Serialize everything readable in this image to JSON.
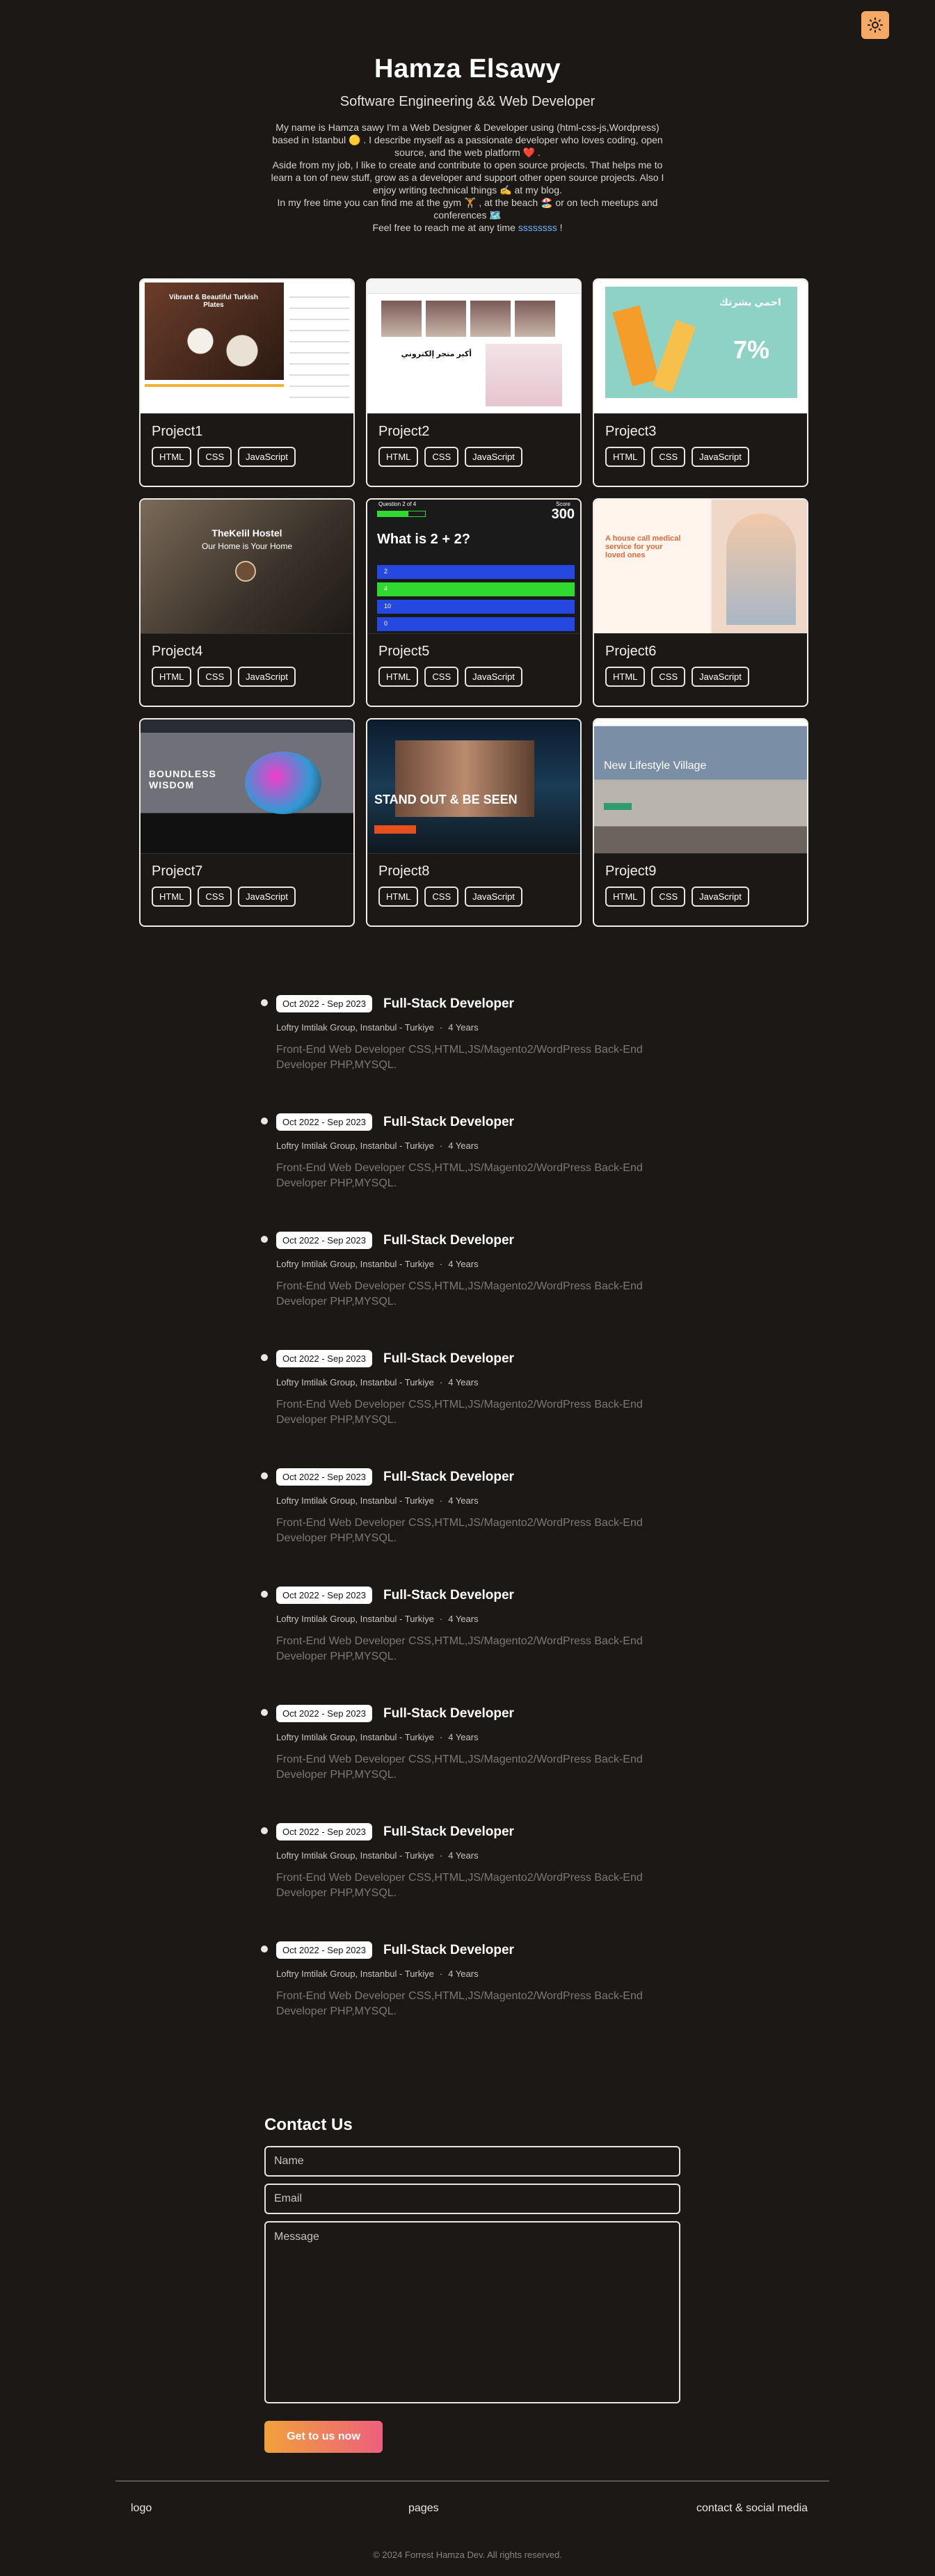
{
  "theme": {
    "toggle_icon": "sun-icon",
    "accent": "#f6a865"
  },
  "hero": {
    "name": "Hamza Elsawy",
    "title": "Software Engineering && Web Developer",
    "bio_lines": [
      "My name is Hamza sawy I'm a Web Designer & Developer using (html-css-js,Wordpress) based in Istanbul 🟡 . I describe myself as a passionate developer who loves coding, open source, and the web platform ❤️ .",
      "Aside from my job, I like to create and contribute to open source projects. That helps me to learn a ton of new stuff, grow as a developer and support other open source projects. Also I enjoy writing technical things ✍️ at my blog.",
      "In my free time you can find me at the gym 🏋️ , at the beach 🏖️ or on tech meetups and conferences 🗺️"
    ],
    "reach_prefix": "Feel free to reach me at any time",
    "reach_link": "ssssssss",
    "reach_suffix": "!"
  },
  "projects": [
    {
      "title": "Project1",
      "tags": [
        "HTML",
        "CSS",
        "JavaScript"
      ]
    },
    {
      "title": "Project2",
      "tags": [
        "HTML",
        "CSS",
        "JavaScript"
      ]
    },
    {
      "title": "Project3",
      "tags": [
        "HTML",
        "CSS",
        "JavaScript"
      ]
    },
    {
      "title": "Project4",
      "tags": [
        "HTML",
        "CSS",
        "JavaScript"
      ]
    },
    {
      "title": "Project5",
      "tags": [
        "HTML",
        "CSS",
        "JavaScript"
      ]
    },
    {
      "title": "Project6",
      "tags": [
        "HTML",
        "CSS",
        "JavaScript"
      ]
    },
    {
      "title": "Project7",
      "tags": [
        "HTML",
        "CSS",
        "JavaScript"
      ]
    },
    {
      "title": "Project8",
      "tags": [
        "HTML",
        "CSS",
        "JavaScript"
      ]
    },
    {
      "title": "Project9",
      "tags": [
        "HTML",
        "CSS",
        "JavaScript"
      ]
    }
  ],
  "thumbs": {
    "p1_heading": "Vibrant & Beautiful Turkish Plates",
    "p2_heading": "أكبر متجر إلكتروني",
    "p3_heading": "احمي بشرتك",
    "p3_percent": "7%",
    "p4_heading": "TheKelil Hostel",
    "p4_sub": "Our Home is Your Home",
    "p5_counter": "Question 2 of 4",
    "p5_score_label": "Score",
    "p5_score": "300",
    "p5_question": "What is 2 + 2?",
    "p5_answers": [
      "2",
      "4",
      "10",
      "0"
    ],
    "p6_heading": "A house call medical service for your loved ones",
    "p7_heading": "BOUNDLESS WISDOM",
    "p8_heading": "STAND OUT & BE SEEN",
    "p9_heading": "New Lifestyle Village"
  },
  "experience": [
    {
      "date": "Oct 2022 - Sep 2023",
      "role": "Full-Stack Developer",
      "company": "Loftry Imtilak Group, Instanbul - Turkiye",
      "duration": "4 Years",
      "description": "Front-End Web Developer CSS,HTML,JS/Magento2/WordPress Back-End Developer PHP,MYSQL."
    },
    {
      "date": "Oct 2022 - Sep 2023",
      "role": "Full-Stack Developer",
      "company": "Loftry Imtilak Group, Instanbul - Turkiye",
      "duration": "4 Years",
      "description": "Front-End Web Developer CSS,HTML,JS/Magento2/WordPress Back-End Developer PHP,MYSQL."
    },
    {
      "date": "Oct 2022 - Sep 2023",
      "role": "Full-Stack Developer",
      "company": "Loftry Imtilak Group, Instanbul - Turkiye",
      "duration": "4 Years",
      "description": "Front-End Web Developer CSS,HTML,JS/Magento2/WordPress Back-End Developer PHP,MYSQL."
    },
    {
      "date": "Oct 2022 - Sep 2023",
      "role": "Full-Stack Developer",
      "company": "Loftry Imtilak Group, Instanbul - Turkiye",
      "duration": "4 Years",
      "description": "Front-End Web Developer CSS,HTML,JS/Magento2/WordPress Back-End Developer PHP,MYSQL."
    },
    {
      "date": "Oct 2022 - Sep 2023",
      "role": "Full-Stack Developer",
      "company": "Loftry Imtilak Group, Instanbul - Turkiye",
      "duration": "4 Years",
      "description": "Front-End Web Developer CSS,HTML,JS/Magento2/WordPress Back-End Developer PHP,MYSQL."
    },
    {
      "date": "Oct 2022 - Sep 2023",
      "role": "Full-Stack Developer",
      "company": "Loftry Imtilak Group, Instanbul - Turkiye",
      "duration": "4 Years",
      "description": "Front-End Web Developer CSS,HTML,JS/Magento2/WordPress Back-End Developer PHP,MYSQL."
    },
    {
      "date": "Oct 2022 - Sep 2023",
      "role": "Full-Stack Developer",
      "company": "Loftry Imtilak Group, Instanbul - Turkiye",
      "duration": "4 Years",
      "description": "Front-End Web Developer CSS,HTML,JS/Magento2/WordPress Back-End Developer PHP,MYSQL."
    },
    {
      "date": "Oct 2022 - Sep 2023",
      "role": "Full-Stack Developer",
      "company": "Loftry Imtilak Group, Instanbul - Turkiye",
      "duration": "4 Years",
      "description": "Front-End Web Developer CSS,HTML,JS/Magento2/WordPress Back-End Developer PHP,MYSQL."
    },
    {
      "date": "Oct 2022 - Sep 2023",
      "role": "Full-Stack Developer",
      "company": "Loftry Imtilak Group, Instanbul - Turkiye",
      "duration": "4 Years",
      "description": "Front-End Web Developer CSS,HTML,JS/Magento2/WordPress Back-End Developer PHP,MYSQL."
    }
  ],
  "contact": {
    "heading": "Contact Us",
    "name_placeholder": "Name",
    "email_placeholder": "Email",
    "message_placeholder": "Message",
    "submit_label": "Get to us now"
  },
  "footer": {
    "logo": "logo",
    "pages": "pages",
    "social": "contact & social media",
    "copyright": "© 2024 Forrest Hamza Dev. All rights reserved."
  }
}
